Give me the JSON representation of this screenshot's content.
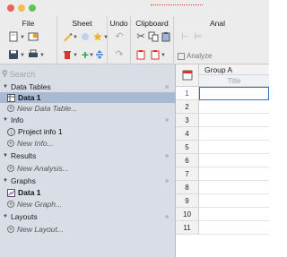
{
  "toolbar": {
    "groups": [
      {
        "label": "File"
      },
      {
        "label": "Sheet"
      },
      {
        "label": "Undo"
      },
      {
        "label": "Clipboard"
      },
      {
        "label": "Anal"
      }
    ],
    "analyze_label": "Analyze"
  },
  "navigator": {
    "search_placeholder": "Search",
    "sections": {
      "data_tables": {
        "label": "Data Tables",
        "items": [
          "Data 1"
        ],
        "new_label": "New Data Table..."
      },
      "info": {
        "label": "Info",
        "items": [
          "Project info 1"
        ],
        "new_label": "New Info..."
      },
      "results": {
        "label": "Results",
        "new_label": "New Analysis..."
      },
      "graphs": {
        "label": "Graphs",
        "items": [
          "Data 1"
        ],
        "new_label": "New Graph..."
      },
      "layouts": {
        "label": "Layouts",
        "new_label": "New Layout..."
      }
    }
  },
  "sheet": {
    "column_header": "Group A",
    "column_subheader": "Title",
    "rows": [
      "1",
      "2",
      "3",
      "4",
      "5",
      "6",
      "7",
      "8",
      "9",
      "10",
      "11"
    ],
    "selected_row": "1"
  },
  "colors": {
    "navigator_bg": "#d8dde6",
    "selected_item_bg": "#a8b9d4",
    "active_cell_border": "#2f6fd6",
    "delete_red": "#d9342b",
    "add_green": "#2ea043"
  }
}
